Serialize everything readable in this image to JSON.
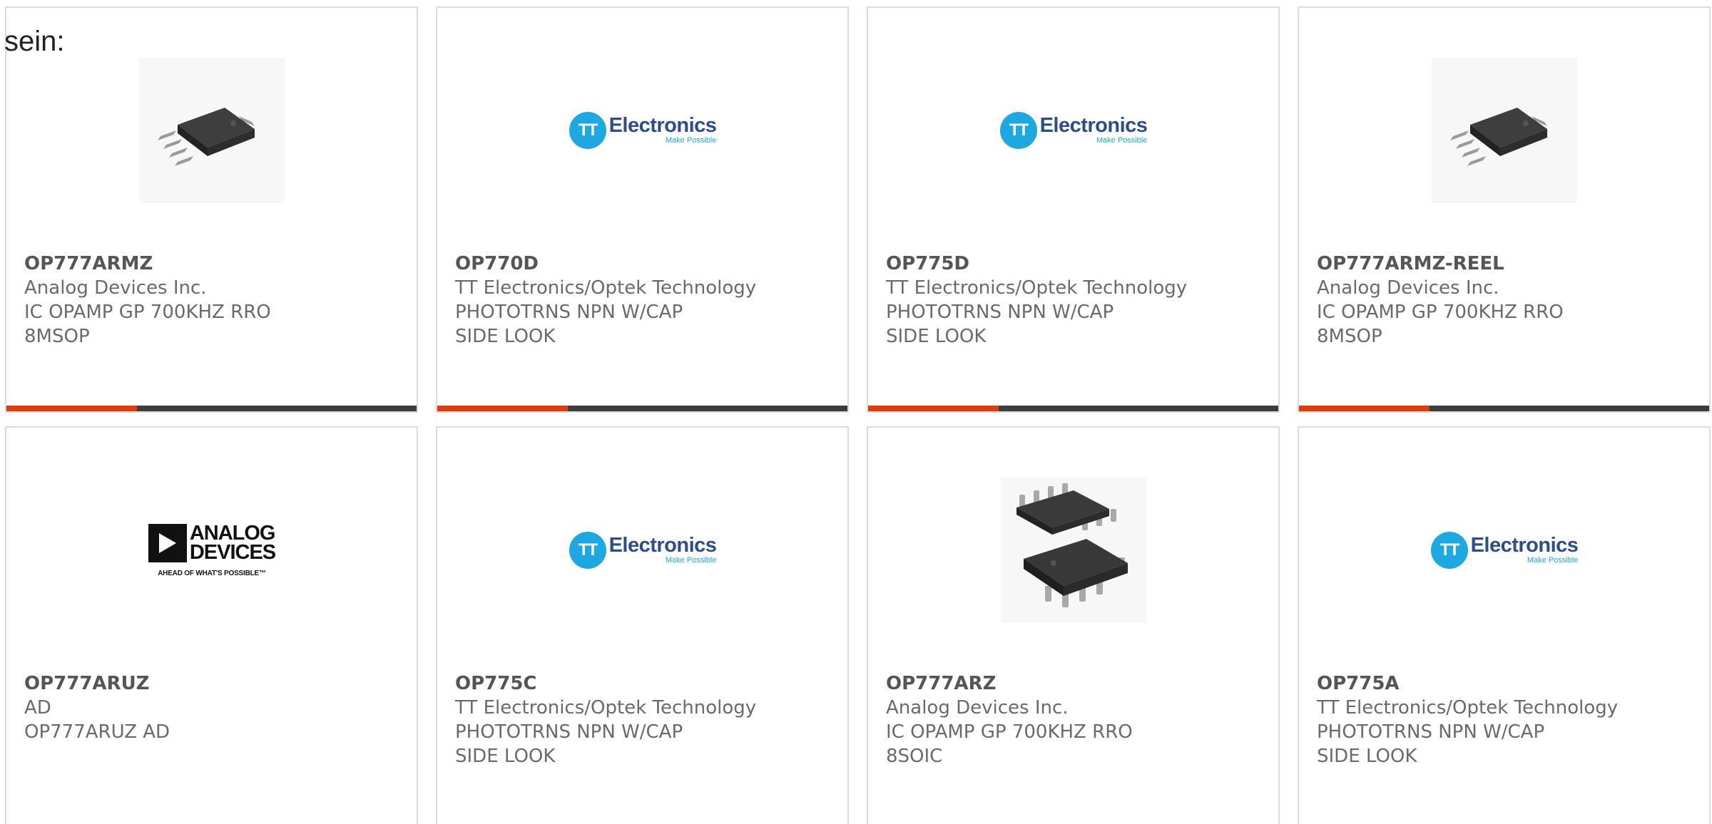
{
  "section_label": "sein:",
  "colors": {
    "accent": "#e33a08",
    "bar": "#3d3d3d",
    "card_border": "#dcdcdc",
    "tt_blue": "#1ea8e1"
  },
  "products": [
    {
      "part_number": "OP777ARMZ",
      "manufacturer": "Analog Devices Inc.",
      "description": "IC OPAMP GP 700KHZ RRO 8MSOP",
      "image": "msop-ic-chip"
    },
    {
      "part_number": "OP770D",
      "manufacturer": "TT Electronics/Optek Technology",
      "description": "PHOTOTRNS NPN W/CAP SIDE LOOK",
      "image": "tt-electronics-logo"
    },
    {
      "part_number": "OP775D",
      "manufacturer": "TT Electronics/Optek Technology",
      "description": "PHOTOTRNS NPN W/CAP SIDE LOOK",
      "image": "tt-electronics-logo"
    },
    {
      "part_number": "OP777ARMZ-REEL",
      "manufacturer": "Analog Devices Inc.",
      "description": "IC OPAMP GP 700KHZ RRO 8MSOP",
      "image": "msop-ic-chip"
    },
    {
      "part_number": "OP777ARUZ",
      "manufacturer": "AD",
      "description": "OP777ARUZ AD",
      "image": "analog-devices-logo"
    },
    {
      "part_number": "OP775C",
      "manufacturer": "TT Electronics/Optek Technology",
      "description": "PHOTOTRNS NPN W/CAP SIDE LOOK",
      "image": "tt-electronics-logo"
    },
    {
      "part_number": "OP777ARZ",
      "manufacturer": "Analog Devices Inc.",
      "description": "IC OPAMP GP 700KHZ RRO 8SOIC",
      "image": "soic-ic-chips"
    },
    {
      "part_number": "OP775A",
      "manufacturer": "TT Electronics/Optek Technology",
      "description": "PHOTOTRNS NPN W/CAP SIDE LOOK",
      "image": "tt-electronics-logo"
    }
  ],
  "logos": {
    "tt": {
      "initials": "TT",
      "name": "Electronics",
      "tagline": "Make Possible"
    },
    "analog_devices": {
      "line1": "ANALOG",
      "line2": "DEVICES",
      "tagline": "AHEAD OF WHAT'S POSSIBLE™"
    }
  }
}
